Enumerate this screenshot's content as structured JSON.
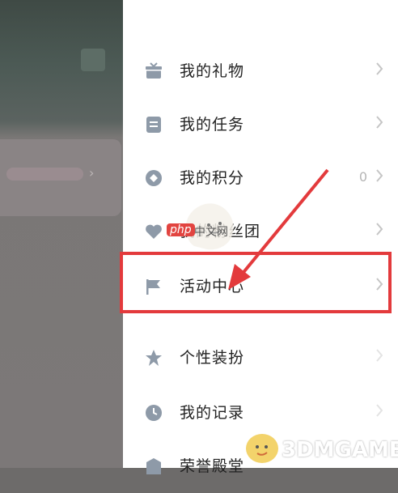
{
  "header": {
    "top_text": ""
  },
  "menu": {
    "items": [
      {
        "label": "我的礼物",
        "icon": "gift-icon"
      },
      {
        "label": "我的任务",
        "icon": "task-icon"
      },
      {
        "label": "我的积分",
        "icon": "points-icon",
        "count": "0"
      },
      {
        "label": "我的粉丝团",
        "icon": "fan-club-icon"
      },
      {
        "label": "活动中心",
        "icon": "flag-icon"
      },
      {
        "label": "个性装扮",
        "icon": "dress-up-icon"
      },
      {
        "label": "我的记录",
        "icon": "history-icon"
      },
      {
        "label": "荣誉殿堂",
        "icon": "honor-icon"
      }
    ]
  },
  "watermarks": {
    "php": "php",
    "php_site": "中文网",
    "game_site": "3DMGAME"
  },
  "colors": {
    "highlight": "#e33a3c",
    "icon": "#8e9aa8",
    "text": "#222222"
  }
}
